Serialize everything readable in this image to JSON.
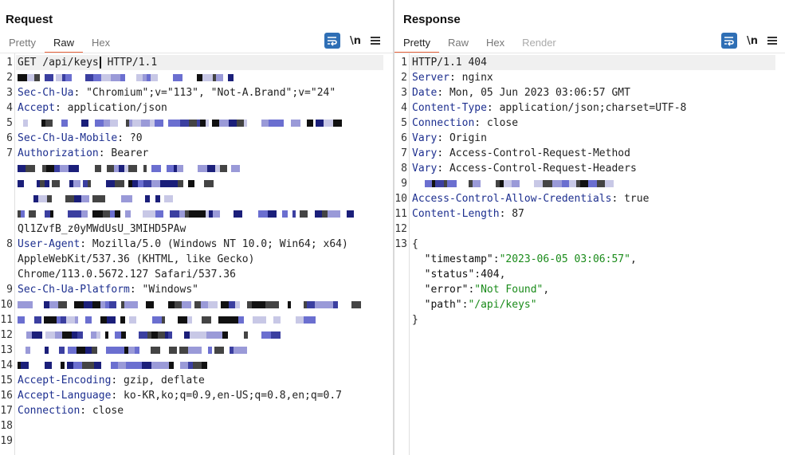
{
  "request": {
    "title": "Request",
    "tabs": [
      {
        "label": "Pretty",
        "active": false
      },
      {
        "label": "Raw",
        "active": true
      },
      {
        "label": "Hex",
        "active": false
      }
    ],
    "newline_label": "\\n",
    "lines": [
      {
        "n": "1",
        "text": "GET /api/keys HTTP/1.1"
      },
      {
        "n": "2",
        "redacted": true
      },
      {
        "n": "3",
        "key": "Sec-Ch-Ua",
        "value": " \"Chromium\";v=\"113\", \"Not-A.Brand\";v=\"24\""
      },
      {
        "n": "4",
        "key": "Accept",
        "value": " application/json"
      },
      {
        "n": "5",
        "redacted": true
      },
      {
        "n": "6",
        "key": "Sec-Ch-Ua-Mobile",
        "value": " ?0"
      },
      {
        "n": "7",
        "key": "Authorization",
        "value": " Bearer"
      },
      {
        "n": "",
        "redacted": true
      },
      {
        "n": "",
        "redacted": true
      },
      {
        "n": "",
        "redacted": true
      },
      {
        "n": "",
        "redacted": true
      },
      {
        "n": "",
        "text": "Ql1ZvfB_z0yMWdUsU_3MIHD5PAw"
      },
      {
        "n": "8",
        "key": "User-Agent",
        "value": " Mozilla/5.0 (Windows NT 10.0; Win64; x64)"
      },
      {
        "n": "",
        "text": "AppleWebKit/537.36 (KHTML, like Gecko)"
      },
      {
        "n": "",
        "text": "Chrome/113.0.5672.127 Safari/537.36"
      },
      {
        "n": "9",
        "key": "Sec-Ch-Ua-Platform",
        "value": " \"Windows\""
      },
      {
        "n": "10",
        "redacted": true
      },
      {
        "n": "11",
        "redacted": true
      },
      {
        "n": "12",
        "redacted": true
      },
      {
        "n": "13",
        "redacted": true
      },
      {
        "n": "14",
        "redacted": true
      },
      {
        "n": "15",
        "key": "Accept-Encoding",
        "value": " gzip, deflate"
      },
      {
        "n": "16",
        "key": "Accept-Language",
        "value": " ko-KR,ko;q=0.9,en-US;q=0.8,en;q=0.7"
      },
      {
        "n": "17",
        "key": "Connection",
        "value": " close"
      },
      {
        "n": "18",
        "text": ""
      },
      {
        "n": "19",
        "text": ""
      }
    ]
  },
  "response": {
    "title": "Response",
    "tabs": [
      {
        "label": "Pretty",
        "active": true
      },
      {
        "label": "Raw",
        "active": false
      },
      {
        "label": "Hex",
        "active": false
      },
      {
        "label": "Render",
        "active": false,
        "disabled": true
      }
    ],
    "newline_label": "\\n",
    "lines": [
      {
        "n": "1",
        "text": "HTTP/1.1 404"
      },
      {
        "n": "2",
        "key": "Server",
        "value": " nginx"
      },
      {
        "n": "3",
        "key": "Date",
        "value": " Mon, 05 Jun 2023 03:06:57 GMT"
      },
      {
        "n": "4",
        "key": "Content-Type",
        "value": " application/json;charset=UTF-8"
      },
      {
        "n": "5",
        "key": "Connection",
        "value": " close"
      },
      {
        "n": "6",
        "key": "Vary",
        "value": " Origin"
      },
      {
        "n": "7",
        "key": "Vary",
        "value": " Access-Control-Request-Method"
      },
      {
        "n": "8",
        "key": "Vary",
        "value": " Access-Control-Request-Headers"
      },
      {
        "n": "9",
        "redacted": true
      },
      {
        "n": "10",
        "key": "Access-Control-Allow-Credentials",
        "value": " true"
      },
      {
        "n": "11",
        "key": "Content-Length",
        "value": " 87"
      },
      {
        "n": "12",
        "text": ""
      },
      {
        "n": "13",
        "text": "{"
      },
      {
        "n": "",
        "json": [
          {
            "t": "  ",
            "c": "val"
          },
          {
            "t": "\"timestamp\"",
            "c": "jkey"
          },
          {
            "t": ":",
            "c": "val"
          },
          {
            "t": "\"2023-06-05 03:06:57\"",
            "c": "jstr"
          },
          {
            "t": ",",
            "c": "val"
          }
        ]
      },
      {
        "n": "",
        "json": [
          {
            "t": "  ",
            "c": "val"
          },
          {
            "t": "\"status\"",
            "c": "jkey"
          },
          {
            "t": ":",
            "c": "val"
          },
          {
            "t": "404",
            "c": "jnum"
          },
          {
            "t": ",",
            "c": "val"
          }
        ]
      },
      {
        "n": "",
        "json": [
          {
            "t": "  ",
            "c": "val"
          },
          {
            "t": "\"error\"",
            "c": "jkey"
          },
          {
            "t": ":",
            "c": "val"
          },
          {
            "t": "\"Not Found\"",
            "c": "jstr"
          },
          {
            "t": ",",
            "c": "val"
          }
        ]
      },
      {
        "n": "",
        "json": [
          {
            "t": "  ",
            "c": "val"
          },
          {
            "t": "\"path\"",
            "c": "jkey"
          },
          {
            "t": ":",
            "c": "val"
          },
          {
            "t": "\"/api/keys\"",
            "c": "jstr"
          }
        ]
      },
      {
        "n": "",
        "text": "}"
      }
    ]
  }
}
